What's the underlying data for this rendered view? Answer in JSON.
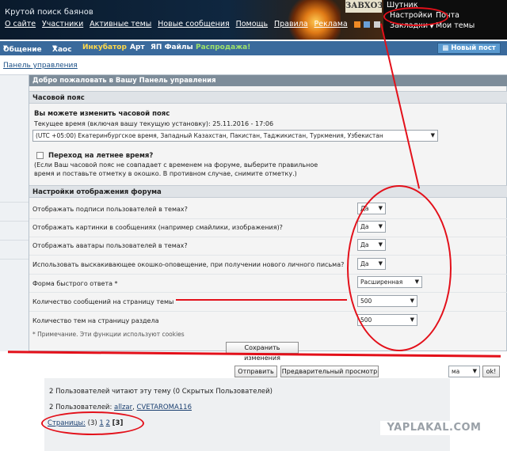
{
  "header": {
    "site_title": "Крутой поиск баянов",
    "nav": [
      "О сайте",
      "Участники",
      "Активные темы",
      "Новые сообщения",
      "Помощь",
      "Правила",
      "Реклама"
    ],
    "logo_text": "ЗАВХОЗ",
    "user": {
      "name": "Шутник",
      "settings": "Настройки",
      "mail": "Почта",
      "bookmarks": "Закладки",
      "my_topics": "Мои темы"
    }
  },
  "menu": {
    "items": [
      "Общение",
      "Хаос",
      "Инкубатор",
      "Арт",
      "ЯП Файлы",
      "Распродажа!"
    ],
    "new_post": "Новый пост"
  },
  "breadcrumb": "Панель управления",
  "panel": {
    "title": "Добро пожаловать в Вашу Панель управления",
    "timezone": {
      "section": "Часовой пояс",
      "heading": "Вы можете изменить часовой пояс",
      "current_time": "Текущее время (включая вашу текущую установку): 25.11.2016 - 17:06",
      "selected": "(UTC +05:00) Екатеринбургское время, Западный Казахстан, Пакистан, Таджикистан, Туркмения, Узбекистан",
      "dst_label": "Переход на летнее время?",
      "dst_note_1": "(Если Ваш часовой пояс не совпадает с временем на форуме, выберите правильное",
      "dst_note_2": "время и поставьте отметку в окошко. В противном случае, снимите отметку.)"
    },
    "display": {
      "section": "Настройки отображения форума",
      "rows": [
        {
          "label": "Отображать подписи пользователей в темах?",
          "value": "Да"
        },
        {
          "label": "Отображать картинки в сообщениях (например смайлики, изображения)?",
          "value": "Да"
        },
        {
          "label": "Отображать аватары пользователей в темах?",
          "value": "Да"
        },
        {
          "label": "Использовать выскакивающее окошко-оповещение, при получении нового личного письма?",
          "value": "Да"
        },
        {
          "label": "Форма быстрого ответа *",
          "value": "Расширенная"
        },
        {
          "label": "Количество сообщений на страницу темы",
          "value": "500"
        },
        {
          "label": "Количество тем на страницу раздела",
          "value": "500"
        }
      ],
      "note": "* Примечание. Эти функции используют cookies",
      "save": "Сохранить изменения"
    }
  },
  "reply": {
    "send": "Отправить",
    "preview": "Предварительный просмотр",
    "select_fragment": "ма",
    "ok": "ok!"
  },
  "readers": {
    "line": "2 Пользователей читают эту тему (0 Скрытых Пользователей)",
    "users_prefix": "2 Пользователей:",
    "user1": "allzar",
    "separator": ",",
    "user2": "CVETAROMA116"
  },
  "pages": {
    "label": "Страницы:",
    "count": "(3)",
    "p1": "1",
    "p2": "2",
    "current": "[3]"
  },
  "watermark": "YAPLAKAL.COM",
  "colors": {
    "menu_blue": "#3a6a9c",
    "panel_head": "#7d8c99",
    "annotation_red": "#e3101a",
    "link": "#1a4f86"
  }
}
